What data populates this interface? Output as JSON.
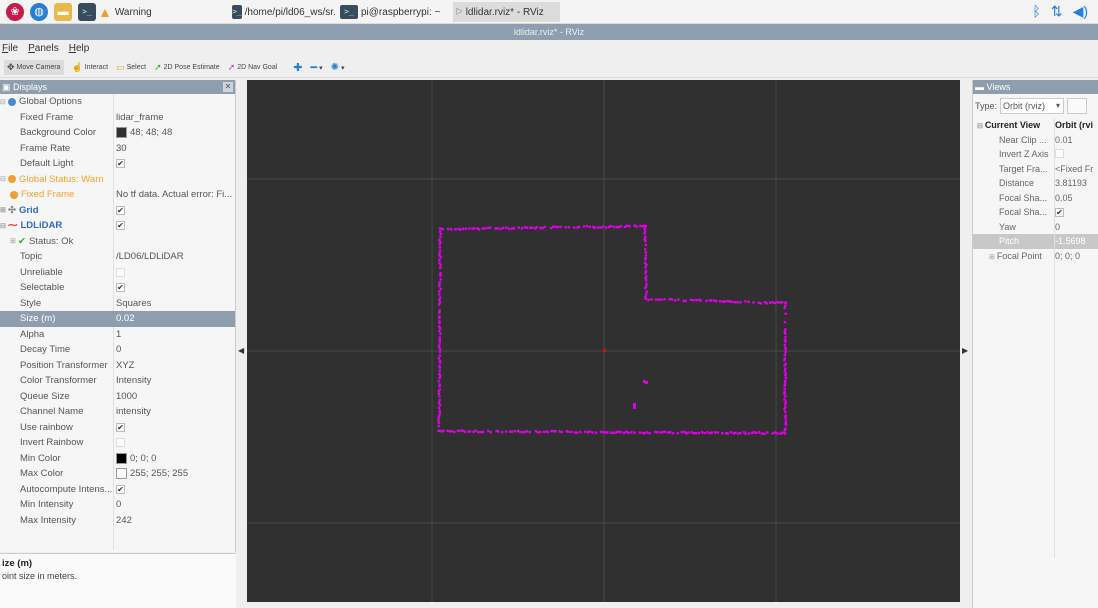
{
  "taskbar": {
    "warning_label": "Warning",
    "tasks": [
      "/home/pi/ld06_ws/sr...",
      "pi@raspberrypi: ~",
      "ldlidar.rviz* - RViz"
    ]
  },
  "window": {
    "title": "ldlidar.rviz* - RViz"
  },
  "menu": [
    "File",
    "Panels",
    "Help"
  ],
  "toolbar": {
    "move_camera": "Move Camera",
    "interact": "Interact",
    "select": "Select",
    "pose_estimate": "2D Pose Estimate",
    "nav_goal": "2D Nav Goal"
  },
  "displays": {
    "title": "Displays",
    "global_options": "Global Options",
    "fixed_frame_label": "Fixed Frame",
    "fixed_frame_value": "lidar_frame",
    "bg_color_label": "Background Color",
    "bg_color_value": "48; 48; 48",
    "frame_rate_label": "Frame Rate",
    "frame_rate_value": "30",
    "default_light_label": "Default Light",
    "global_status": "Global Status: Warn",
    "fixed_frame_warn_label": "Fixed Frame",
    "fixed_frame_warn_value": "No tf data.  Actual error: Fi...",
    "grid_label": "Grid",
    "ldlidar_label": "LDLiDAR",
    "status_label": "Status: Ok",
    "topic_label": "Topic",
    "topic_value": "/LD06/LDLiDAR",
    "unreliable_label": "Unreliable",
    "selectable_label": "Selectable",
    "style_label": "Style",
    "style_value": "Squares",
    "size_label": "Size (m)",
    "size_value": "0.02",
    "alpha_label": "Alpha",
    "alpha_value": "1",
    "decay_label": "Decay Time",
    "decay_value": "0",
    "pos_tf_label": "Position Transformer",
    "pos_tf_value": "XYZ",
    "color_tf_label": "Color Transformer",
    "color_tf_value": "Intensity",
    "queue_label": "Queue Size",
    "queue_value": "1000",
    "channel_label": "Channel Name",
    "channel_value": "intensity",
    "rainbow_label": "Use rainbow",
    "invert_rainbow_label": "Invert Rainbow",
    "min_color_label": "Min Color",
    "min_color_value": "0; 0; 0",
    "max_color_label": "Max Color",
    "max_color_value": "255; 255; 255",
    "autocompute_label": "Autocompute Intens...",
    "min_int_label": "Min Intensity",
    "min_int_value": "0",
    "max_int_label": "Max Intensity",
    "max_int_value": "242",
    "desc_title": "ize (m)",
    "desc_text": "oint size in meters."
  },
  "views": {
    "title": "Views",
    "type_label": "Type:",
    "type_value": "Orbit (rviz)",
    "current_view": "Current View",
    "current_view_value": "Orbit (rvi",
    "near_clip": "Near Clip ...",
    "near_clip_value": "0.01",
    "invert_z": "Invert Z Axis",
    "target_frame": "Target Fra...",
    "target_frame_value": "<Fixed Fr",
    "distance": "Distance",
    "distance_value": "3.81193",
    "focal_shape1": "Focal Sha...",
    "focal_shape1_value": "0.05",
    "focal_shape2": "Focal Sha...",
    "yaw": "Yaw",
    "yaw_value": "0",
    "pitch": "Pitch",
    "pitch_value": "-1.5698",
    "focal_point": "Focal Point",
    "focal_point_value": "0; 0; 0"
  },
  "colors": {
    "header": "#8e9eae",
    "viewport_bg": "#303030",
    "points": "#e000e8",
    "grid": "#4a4a4a"
  }
}
